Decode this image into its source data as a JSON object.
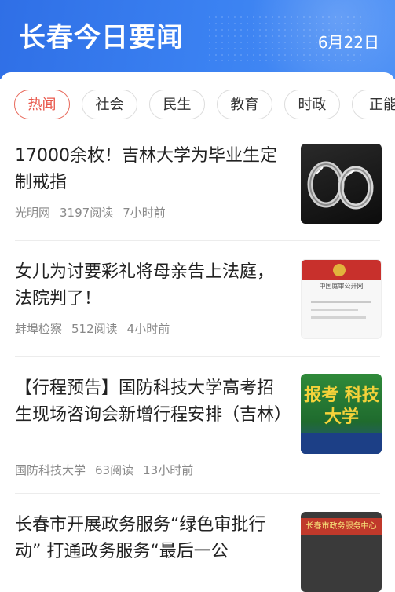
{
  "header": {
    "title": "长春今日要闻",
    "date": "6月22日"
  },
  "tabs": [
    {
      "label": "热闻",
      "active": true
    },
    {
      "label": "社会",
      "active": false
    },
    {
      "label": "民生",
      "active": false
    },
    {
      "label": "教育",
      "active": false
    },
    {
      "label": "时政",
      "active": false
    },
    {
      "label": "正能",
      "active": false
    }
  ],
  "news": [
    {
      "headline": "17000余枚！吉林大学为毕业生定制戒指",
      "source": "光明网",
      "reads": "3197阅读",
      "time": "7小时前",
      "thumb_icon": "rings-photo"
    },
    {
      "headline": "女儿为讨要彩礼将母亲告上法庭，法院判了！",
      "source": "蚌埠检察",
      "reads": "512阅读",
      "time": "4小时前",
      "thumb_icon": "court-document-photo",
      "thumb_text": "中国庭审公开网"
    },
    {
      "headline": "【行程预告】国防科技大学高考招生现场咨询会新增行程安排（吉林）",
      "source": "国防科技大学",
      "reads": "63阅读",
      "time": "13小时前",
      "thumb_icon": "university-poster",
      "thumb_text": "报考 科技大学"
    },
    {
      "headline": "长春市开展政务服务“绿色审批行动” 打通政务服务“最后一公",
      "thumb_icon": "service-center-sign",
      "thumb_text": "长春市政务服务中心"
    }
  ],
  "colors": {
    "accent": "#e8564a",
    "header_blue": "#3b82f2"
  }
}
